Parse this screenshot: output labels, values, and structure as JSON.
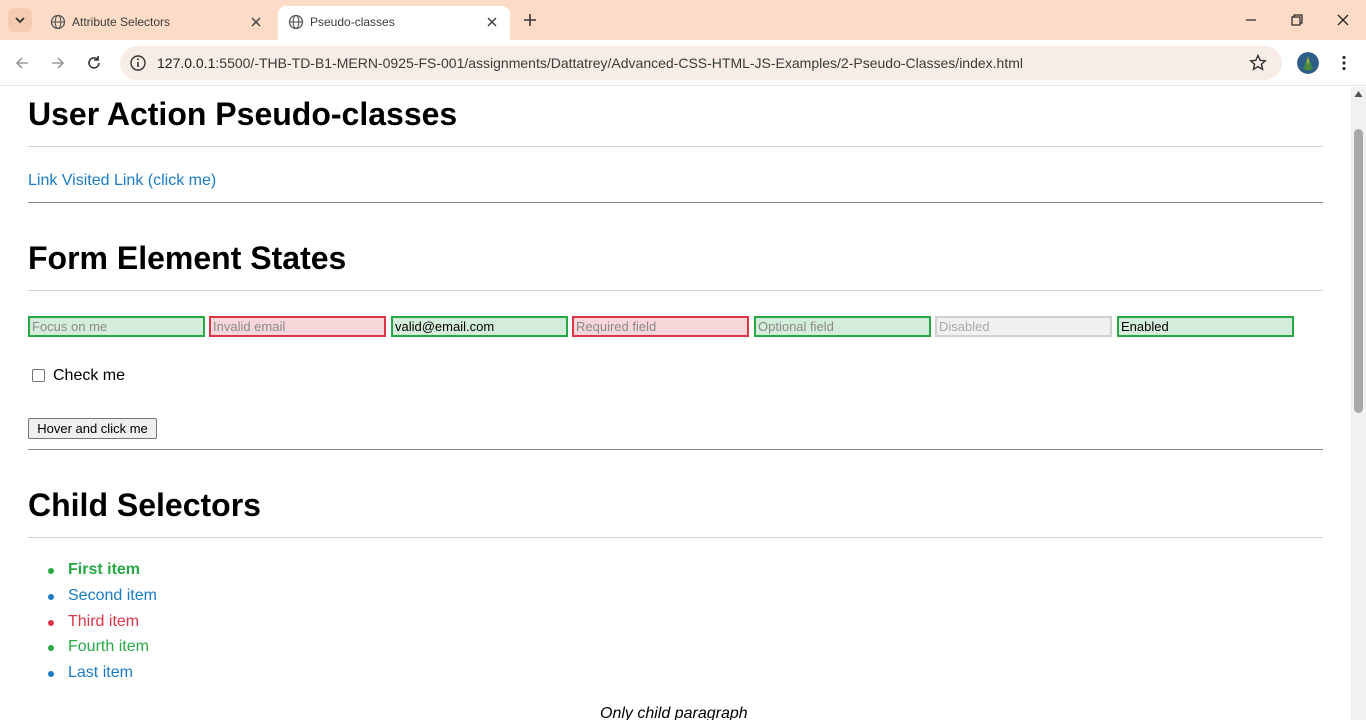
{
  "browser": {
    "tabs": [
      {
        "title": "Attribute Selectors",
        "active": false
      },
      {
        "title": "Pseudo-classes",
        "active": true
      }
    ],
    "url_host": "127.0.0.1",
    "url_path": ":5500/-THB-TD-B1-MERN-0925-FS-001/assignments/Dattatrey/Advanced-CSS-HTML-JS-Examples/2-Pseudo-Classes/index.html"
  },
  "page": {
    "section1": {
      "heading": "User Action Pseudo-classes",
      "link_text": "Link Visited Link (click me)"
    },
    "section2": {
      "heading": "Form Element States",
      "fields": [
        {
          "placeholder": "Focus on me",
          "value": "",
          "state": "valid"
        },
        {
          "placeholder": "Invalid email",
          "value": "",
          "state": "invalid"
        },
        {
          "placeholder": "",
          "value": "valid@email.com",
          "state": "valid"
        },
        {
          "placeholder": "Required field",
          "value": "",
          "state": "invalid"
        },
        {
          "placeholder": "Optional field",
          "value": "",
          "state": "valid"
        },
        {
          "placeholder": "Disabled",
          "value": "",
          "state": "disabled"
        },
        {
          "placeholder": "",
          "value": "Enabled",
          "state": "valid"
        }
      ],
      "checkbox_label": "Check me",
      "checkbox_checked": false,
      "button_label": "Hover and click me"
    },
    "section3": {
      "heading": "Child Selectors",
      "items": [
        {
          "text": "First item",
          "color": "#28a745",
          "bold": true
        },
        {
          "text": "Second item",
          "color": "#1a7bc4",
          "bold": false
        },
        {
          "text": "Third item",
          "color": "#dc3545",
          "bold": false
        },
        {
          "text": "Fourth item",
          "color": "#28a745",
          "bold": false
        },
        {
          "text": "Last item",
          "color": "#1a7bc4",
          "bold": false
        }
      ],
      "only_child_paragraph": "Only child paragraph"
    }
  },
  "colors": {
    "tabstrip": "#fcdcc7",
    "link": "#1a7bc4",
    "valid_border": "#28a745",
    "invalid_border": "#dc3545"
  }
}
